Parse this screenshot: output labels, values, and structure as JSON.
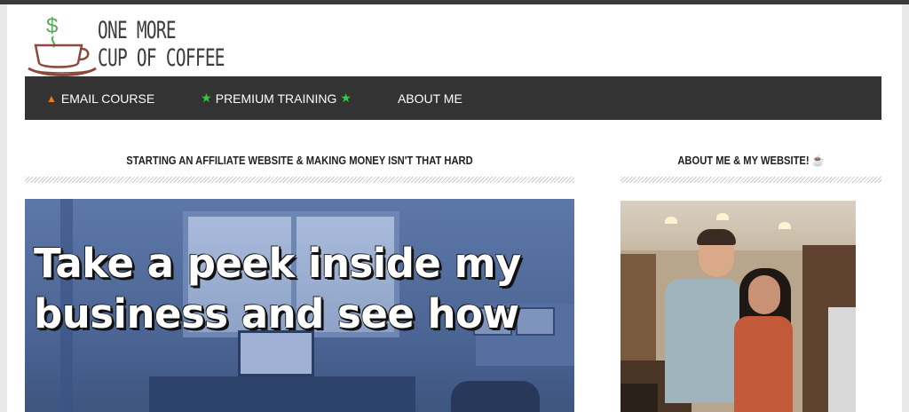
{
  "logo": {
    "line1": "ONE MORE",
    "line2": "CUP OF COFFEE",
    "icon": "coffee-cup-dollar-logo"
  },
  "nav": {
    "items": [
      {
        "label": "EMAIL COURSE",
        "icon": "fire-icon"
      },
      {
        "label": "PREMIUM TRAINING",
        "icon": "star-icon"
      },
      {
        "label": "ABOUT ME"
      }
    ]
  },
  "main": {
    "heading": "STARTING AN AFFILIATE WEBSITE & MAKING MONEY ISN'T THAT HARD",
    "hero_line1": "Take a peek inside my",
    "hero_line2": "business and see how"
  },
  "sidebar": {
    "heading": "ABOUT ME & MY WEBSITE! ☕"
  },
  "colors": {
    "nav_bg": "#333333",
    "flame": "#f07a1a",
    "star": "#2ecc40",
    "logo_dollar": "#4caf50",
    "logo_cup": "#8b4a3c"
  }
}
